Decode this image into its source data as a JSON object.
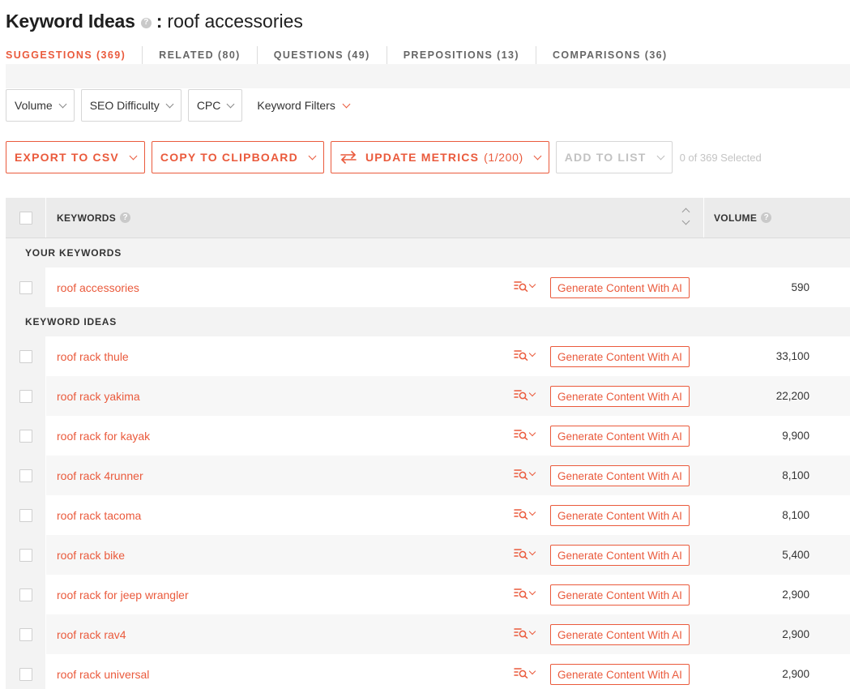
{
  "header": {
    "title": "Keyword Ideas",
    "colon": ":",
    "query": "roof accessories",
    "help": "?"
  },
  "tabs": [
    {
      "label": "SUGGESTIONS (369)",
      "active": true
    },
    {
      "label": "RELATED (80)",
      "active": false
    },
    {
      "label": "QUESTIONS (49)",
      "active": false
    },
    {
      "label": "PREPOSITIONS (13)",
      "active": false
    },
    {
      "label": "COMPARISONS (36)",
      "active": false
    }
  ],
  "filters": {
    "volume": "Volume",
    "seo_difficulty": "SEO Difficulty",
    "cpc": "CPC",
    "keyword_filters": "Keyword Filters"
  },
  "actions": {
    "export": "EXPORT TO CSV",
    "copy": "COPY TO CLIPBOARD",
    "update": "UPDATE METRICS",
    "update_count": "(1/200)",
    "add_to_list": "ADD TO LIST",
    "selected": "0 of 369 Selected"
  },
  "table": {
    "col_keywords": "KEYWORDS",
    "col_volume": "VOLUME",
    "section_yours": "YOUR KEYWORDS",
    "section_ideas": "KEYWORD IDEAS",
    "generate_label": "Generate Content With AI",
    "your_keywords": [
      {
        "keyword": "roof accessories",
        "volume": "590"
      }
    ],
    "keyword_ideas": [
      {
        "keyword": "roof rack thule",
        "volume": "33,100"
      },
      {
        "keyword": "roof rack yakima",
        "volume": "22,200"
      },
      {
        "keyword": "roof rack for kayak",
        "volume": "9,900"
      },
      {
        "keyword": "roof rack 4runner",
        "volume": "8,100"
      },
      {
        "keyword": "roof rack tacoma",
        "volume": "8,100"
      },
      {
        "keyword": "roof rack bike",
        "volume": "5,400"
      },
      {
        "keyword": "roof rack for jeep wrangler",
        "volume": "2,900"
      },
      {
        "keyword": "roof rack rav4",
        "volume": "2,900"
      },
      {
        "keyword": "roof rack universal",
        "volume": "2,900"
      }
    ]
  },
  "colors": {
    "accent": "#ea5a3c",
    "header_bg": "#ebebeb",
    "row_alt": "#f7f7f7"
  }
}
